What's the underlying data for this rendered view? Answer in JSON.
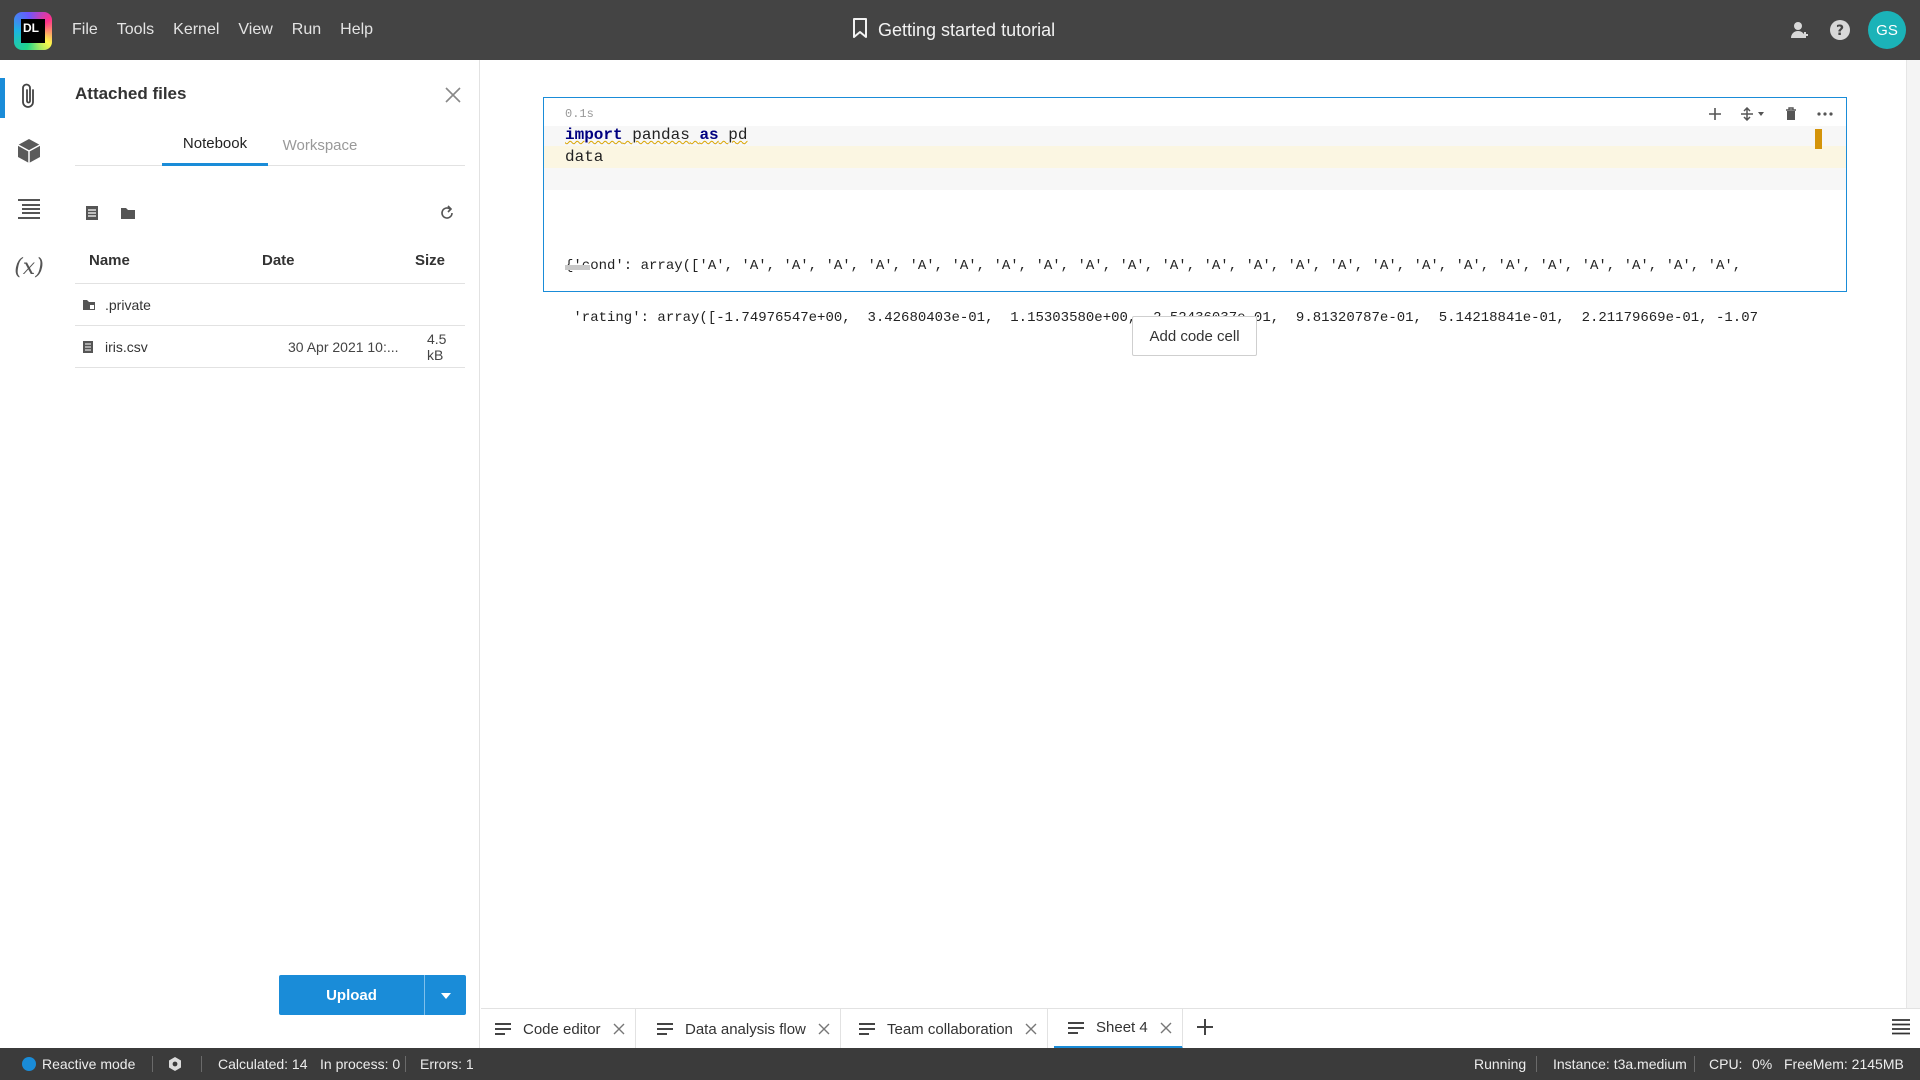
{
  "app": {
    "logo_text": "DL",
    "menu": [
      "File",
      "Tools",
      "Kernel",
      "View",
      "Run",
      "Help"
    ],
    "title": "Getting started tutorial",
    "avatar_initials": "GS"
  },
  "sidebar": {
    "active_item": "attached-files",
    "items": [
      "paperclip-icon",
      "cube-icon",
      "list-icon",
      "variables-icon"
    ],
    "variables_label": "(x)"
  },
  "files_panel": {
    "title": "Attached files",
    "tabs": [
      {
        "label": "Notebook",
        "active": true
      },
      {
        "label": "Workspace",
        "active": false
      }
    ],
    "columns": {
      "name": "Name",
      "date": "Date",
      "size": "Size"
    },
    "rows": [
      {
        "name": ".private",
        "date": "",
        "size": "",
        "type": "folder"
      },
      {
        "name": "iris.csv",
        "date": "30 Apr 2021 10:...",
        "size": "4.5 kB",
        "type": "file"
      }
    ],
    "upload_label": "Upload"
  },
  "cell": {
    "exec_time": "0.1s",
    "code_lines": [
      {
        "import_kw": "import",
        "module": "pandas",
        "as_kw": "as",
        "alias": "pd"
      },
      {
        "text": "data"
      }
    ],
    "output_lines": [
      "{'cond': array(['A', 'A', 'A', 'A', 'A', 'A', 'A', 'A', 'A', 'A', 'A', 'A', 'A', 'A', 'A', 'A', 'A', 'A', 'A', 'A', 'A', 'A', 'A', 'A', 'A',",
      " 'rating': array([-1.74976547e+00,  3.42680403e-01,  1.15303580e+00, -2.52436037e-01,  9.81320787e-01,  5.14218841e-01,  2.21179669e-01, -1.07"
    ]
  },
  "add_cell_label": "Add code cell",
  "sheets": [
    {
      "label": "Code editor",
      "active": false
    },
    {
      "label": "Data analysis flow",
      "active": false
    },
    {
      "label": "Team collaboration",
      "active": false
    },
    {
      "label": "Sheet 4",
      "active": true
    }
  ],
  "status": {
    "mode": "Reactive mode",
    "calculated": "Calculated: 14",
    "in_process": "In process: 0",
    "errors": "Errors: 1",
    "state": "Running",
    "instance": "Instance: t3a.medium",
    "cpu_label": "CPU:",
    "cpu_value": "0%",
    "freemem": "FreeMem:  2145MB"
  },
  "colors": {
    "accent": "#1a8cd8",
    "topbar": "#444444",
    "statusbar": "#3b3b3b",
    "avatar": "#1bb3b8",
    "cell_marker": "#d4940a"
  }
}
